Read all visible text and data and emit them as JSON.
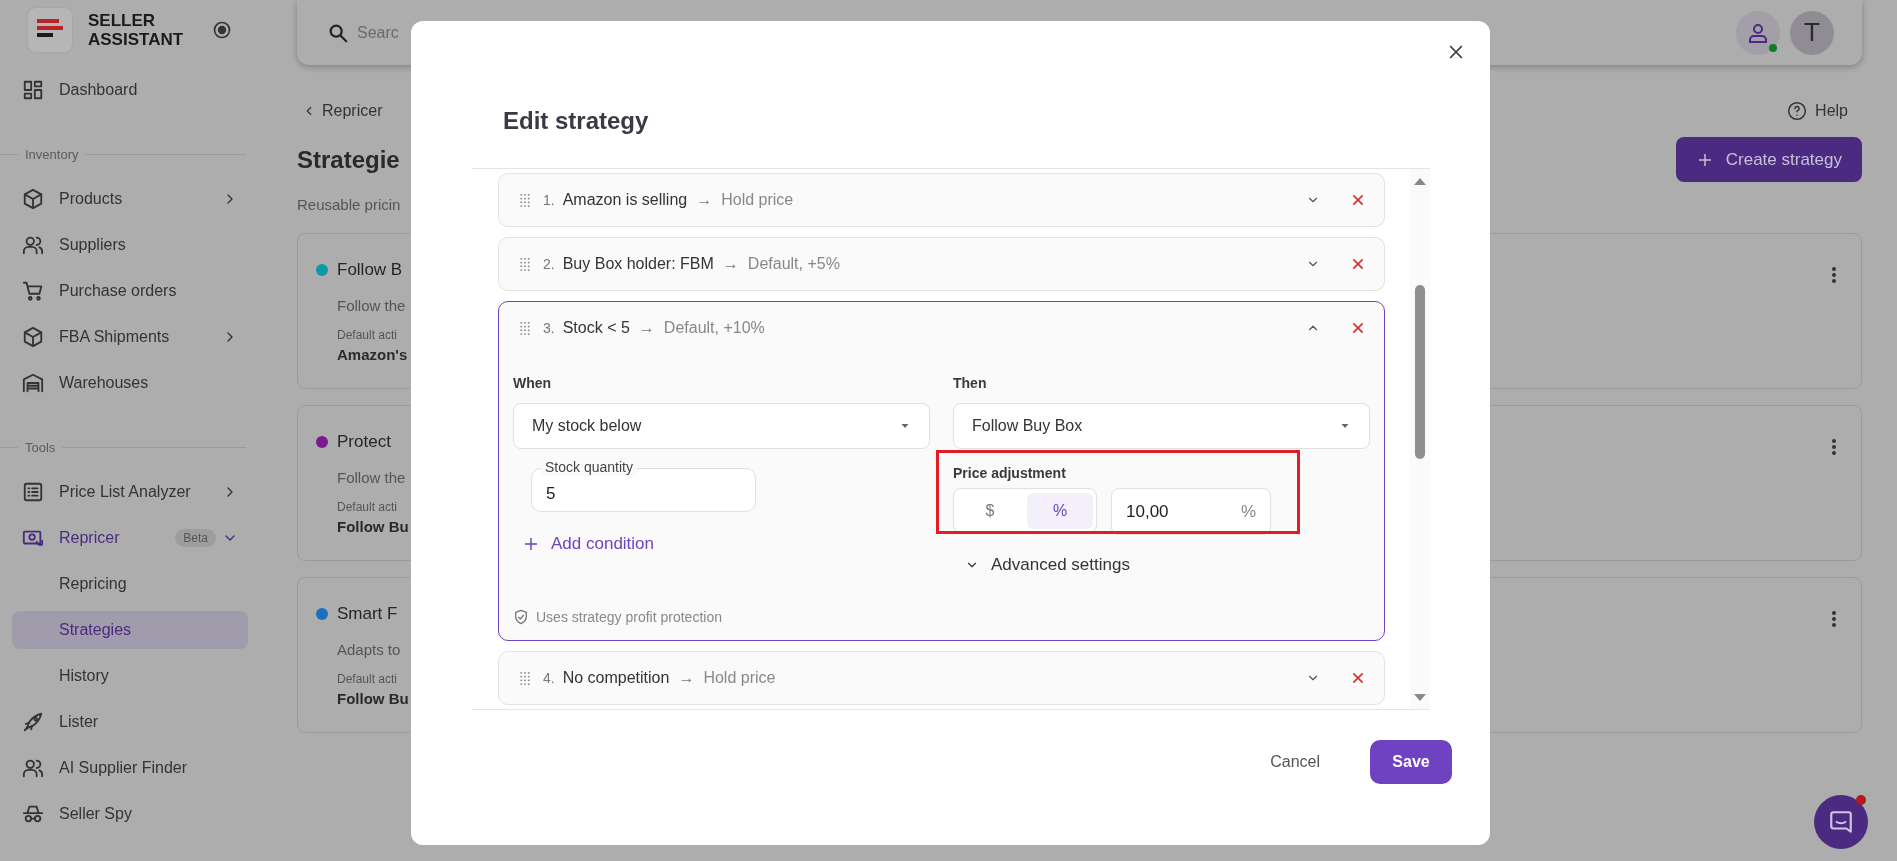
{
  "sidebar": {
    "brand": "SELLER ASSISTANT",
    "sections": [
      {
        "items": [
          {
            "label": "Dashboard",
            "selected": false
          }
        ]
      },
      {
        "title": "Inventory",
        "items": [
          {
            "label": "Products",
            "submenu": true,
            "selected": false
          },
          {
            "label": "Suppliers",
            "selected": false
          },
          {
            "label": "Purchase orders",
            "selected": false
          },
          {
            "label": "FBA Shipments",
            "submenu": true,
            "selected": false
          },
          {
            "label": "Warehouses",
            "selected": false
          }
        ]
      },
      {
        "title": "Tools",
        "items": [
          {
            "label": "Price List Analyzer",
            "submenu": true,
            "selected": false
          },
          {
            "label": "Repricer",
            "badge": "Beta",
            "expanded": true,
            "selected": false,
            "children": [
              {
                "label": "Repricing",
                "selected": false
              },
              {
                "label": "Strategies",
                "selected": true
              },
              {
                "label": "History",
                "selected": false
              }
            ]
          },
          {
            "label": "Lister",
            "selected": false
          },
          {
            "label": "AI Supplier Finder",
            "selected": false
          },
          {
            "label": "Seller Spy",
            "selected": false
          }
        ]
      }
    ]
  },
  "topbar": {
    "search_placeholder": "Searc",
    "avatar_initial": "T"
  },
  "page": {
    "back_link": "Repricer",
    "help": "Help",
    "heading": "Strategie",
    "subtitle": "Reusable pricin",
    "create_button": "Create strategy",
    "cards": [
      {
        "name": "Follow B",
        "color": "#0e97a5",
        "description": "Follow the",
        "default_label": "Default acti",
        "default_value": "Amazon's"
      },
      {
        "name": "Protect",
        "color": "#7b1a8e",
        "description": "Follow the",
        "default_label": "Default acti",
        "default_value": "Follow Bu"
      },
      {
        "name": "Smart F",
        "color": "#1a6fc0",
        "description": "Adapts to",
        "default_label": "Default acti",
        "default_value": "Follow Bu"
      }
    ]
  },
  "modal": {
    "title": "Edit strategy",
    "rules": [
      {
        "number": "1.",
        "condition": "Amazon is selling",
        "arrow": "→",
        "action": "Hold price",
        "expanded": false
      },
      {
        "number": "2.",
        "condition": "Buy Box holder: FBM",
        "arrow": "→",
        "action": "Default, +5%",
        "expanded": false
      },
      {
        "number": "3.",
        "condition": "Stock < 5",
        "arrow": "→",
        "action": "Default, +10%",
        "expanded": true,
        "details": {
          "when_label": "When",
          "when_value": "My stock below",
          "then_label": "Then",
          "then_value": "Follow Buy Box",
          "stock_field": {
            "label": "Stock quantity",
            "value": "5"
          },
          "add_condition": "Add condition",
          "price_adjustment": {
            "label": "Price adjustment",
            "highlighted": true,
            "units": [
              {
                "label": "$",
                "selected": false
              },
              {
                "label": "%",
                "selected": true
              }
            ],
            "value": "10,00",
            "suffix": "%"
          },
          "advanced": "Advanced settings",
          "note": "Uses strategy profit protection"
        }
      },
      {
        "number": "4.",
        "condition": "No competition",
        "arrow": "→",
        "action": "Hold price",
        "expanded": false
      }
    ],
    "cancel": "Cancel",
    "save": "Save"
  }
}
